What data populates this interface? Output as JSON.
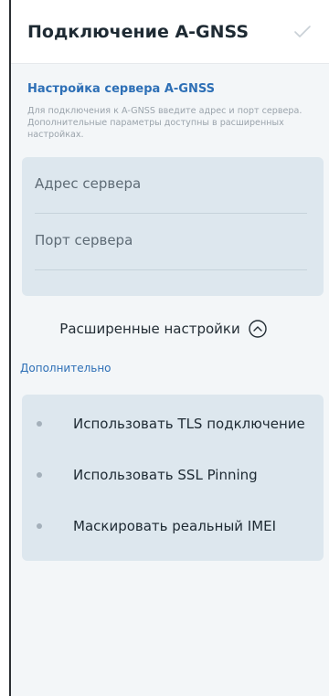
{
  "header": {
    "title": "Подключение A-GNSS",
    "confirm_icon": "check-icon"
  },
  "server_section": {
    "title": "Настройка сервера A-GNSS",
    "description": "Для подключения к A-GNSS введите адрес и порт сервера. Дополнительные параметры доступны в расширенных настройках.",
    "address_placeholder": "Адрес сервера",
    "port_placeholder": "Порт сервера"
  },
  "advanced": {
    "label": "Расширенные настройки",
    "icon": "chevron-up-circle-icon"
  },
  "extra_section": {
    "title": "Дополнительно",
    "options": [
      {
        "label": "Использовать TLS подключение"
      },
      {
        "label": "Использовать SSL Pinning"
      },
      {
        "label": "Маскировать реальный IMEI"
      }
    ]
  }
}
